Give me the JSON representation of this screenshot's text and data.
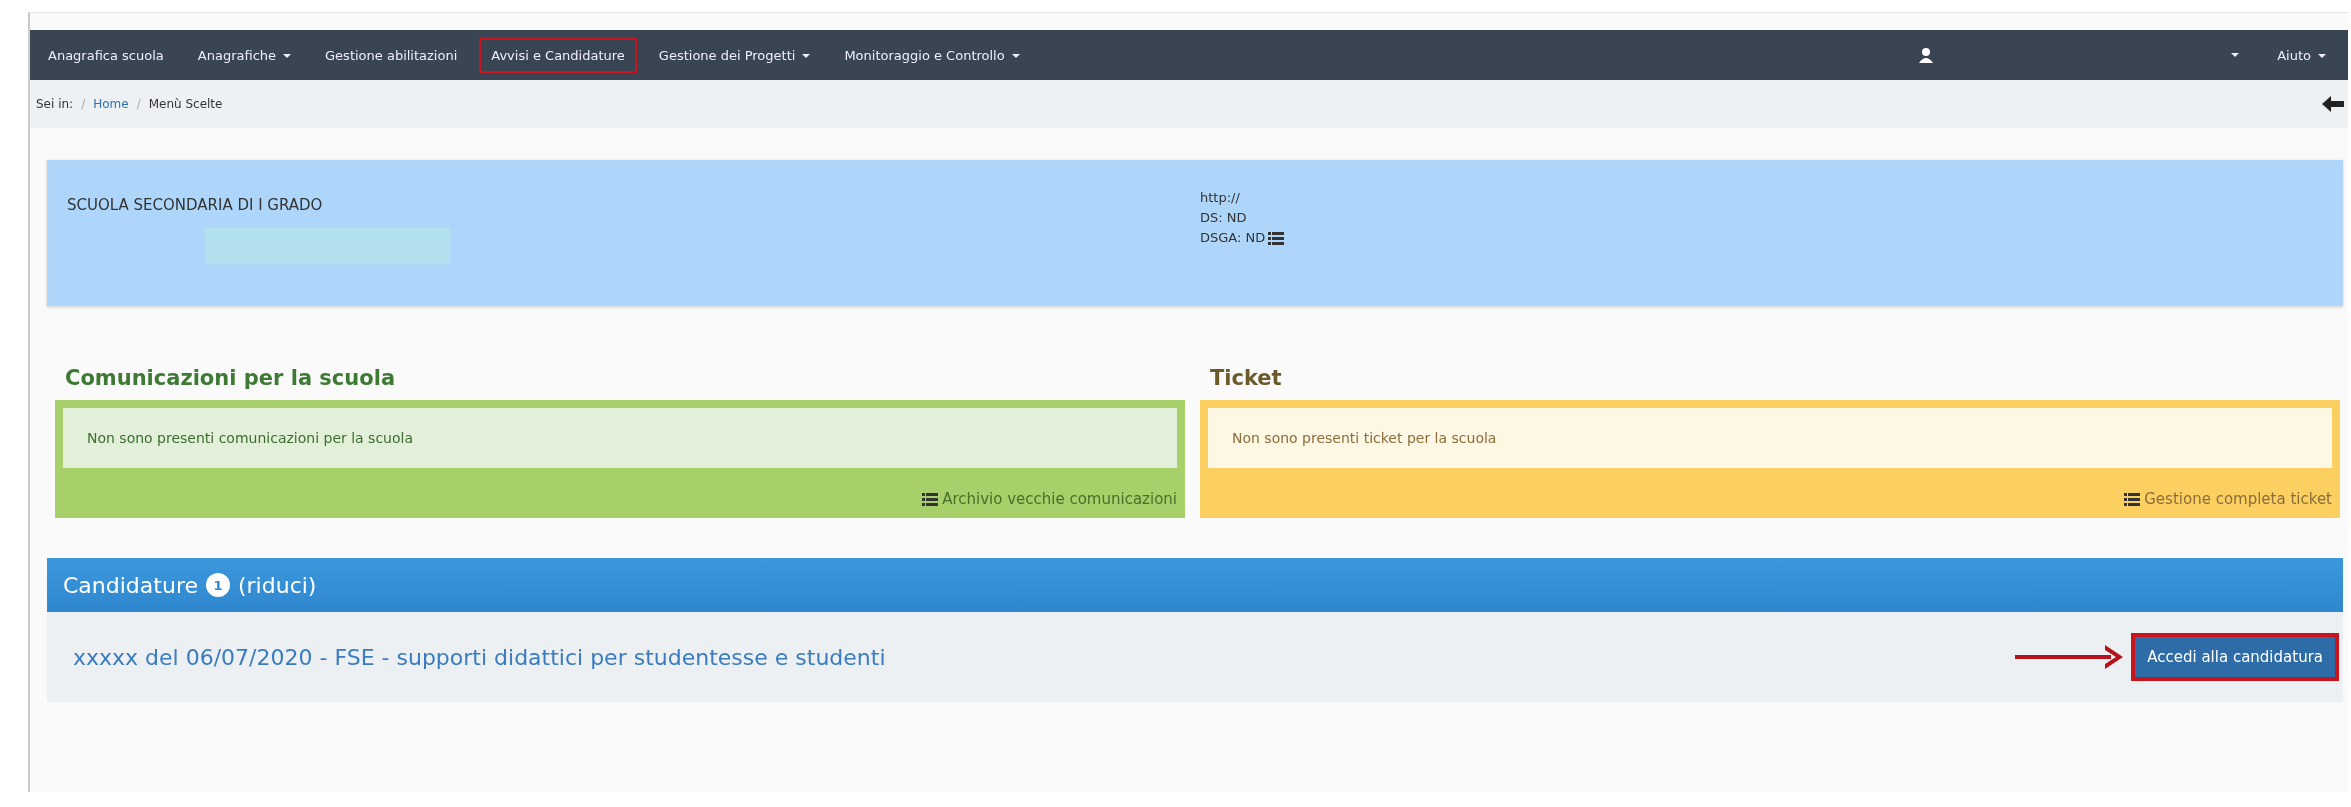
{
  "navbar": {
    "items": [
      {
        "label": "Anagrafica scuola",
        "dropdown": false,
        "highlighted": false
      },
      {
        "label": "Anagrafiche",
        "dropdown": true,
        "highlighted": false
      },
      {
        "label": "Gestione abilitazioni",
        "dropdown": false,
        "highlighted": false
      },
      {
        "label": "Avvisi e Candidature",
        "dropdown": false,
        "highlighted": true
      },
      {
        "label": "Gestione dei Progetti",
        "dropdown": true,
        "highlighted": false
      },
      {
        "label": "Monitoraggio e Controllo",
        "dropdown": true,
        "highlighted": false
      }
    ],
    "help": {
      "label": "Aiuto",
      "dropdown": true
    }
  },
  "breadcrumb": {
    "prefix": "Sei in:",
    "separator": "/",
    "items": [
      {
        "label": "Home",
        "link": true
      },
      {
        "label": "Menù Scelte",
        "link": false
      }
    ]
  },
  "school": {
    "name": "SCUOLA SECONDARIA DI I GRADO",
    "website": "http://",
    "ds": "DS: ND",
    "dsga": "DSGA: ND"
  },
  "panels": [
    {
      "kind": "success",
      "title": "Comunicazioni per la scuola",
      "message": "Non sono presenti comunicazioni per la scuola",
      "link": "Archivio vecchie comunicazioni"
    },
    {
      "kind": "warning",
      "title": "Ticket",
      "message": "Non sono presenti ticket per la scuola",
      "link": "Gestione completa ticket"
    }
  ],
  "candidature": {
    "title": "Candidature",
    "count": "1",
    "toggle": "(riduci)",
    "items": [
      {
        "title": "xxxxx del 06/07/2020 - FSE - supporti didattici per studentesse e studenti",
        "button": "Accedi alla candidatura",
        "highlighted": true
      }
    ]
  }
}
